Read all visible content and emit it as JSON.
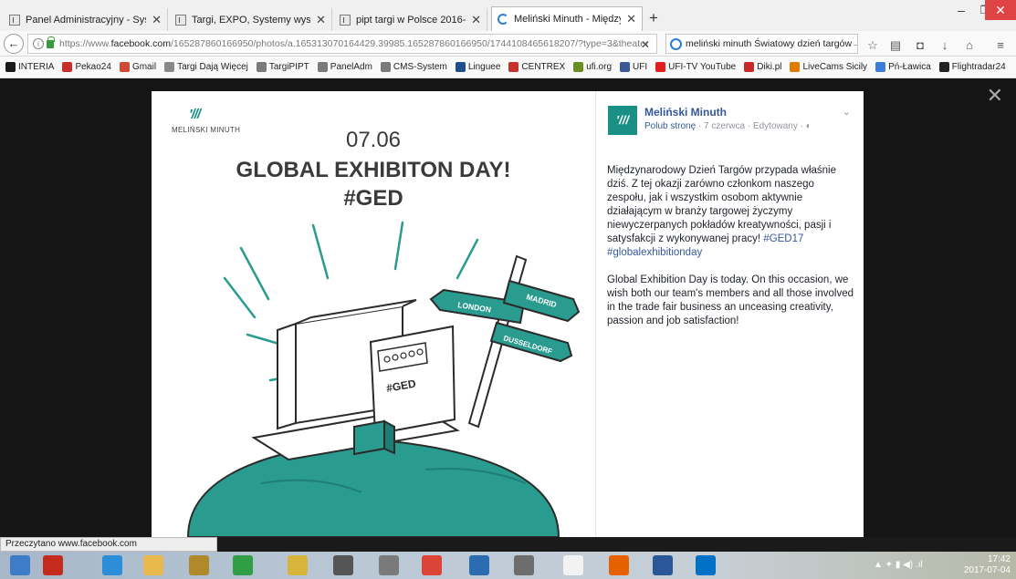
{
  "browser": {
    "tabs": [
      {
        "label": "Panel Administracyjny - Syst",
        "active": false
      },
      {
        "label": "Targi, EXPO, Systemy wystaw",
        "active": false
      },
      {
        "label": "pipt targi w Polsce 2016-cale",
        "active": false
      },
      {
        "label": "Meliński Minuth - Międzyna",
        "active": true
      }
    ],
    "new_tab": "+",
    "window_controls": {
      "minimize": "–",
      "restore": "❐",
      "close": "✕"
    },
    "url": {
      "prefix": "https://www.",
      "domain": "facebook.com",
      "path": "/165287860166950/photos/a.165313070164429.39985.165287860166950/1744108465618207/?type=3&theater"
    },
    "search": {
      "value": "meliński minuth Światowy dzień targów",
      "go": "→"
    },
    "nav_icons": [
      "star-icon",
      "reading-list-icon",
      "pocket-icon",
      "download-icon",
      "home-icon",
      "menu-icon"
    ]
  },
  "bookmarks": [
    {
      "label": "INTERIA",
      "icon": "int",
      "color": "#1a1a1a"
    },
    {
      "label": "Pekao24",
      "icon": "pekao",
      "color": "#c9302c"
    },
    {
      "label": "Gmail",
      "icon": "M",
      "color": "#d14836"
    },
    {
      "label": "Targi Dają Więcej",
      "icon": "TDW",
      "color": "#888888"
    },
    {
      "label": "TargiPIPT",
      "icon": "page",
      "color": "#7a7a7a"
    },
    {
      "label": "PanelAdm",
      "icon": "page",
      "color": "#7a7a7a"
    },
    {
      "label": "CMS-System",
      "icon": "page",
      "color": "#7a7a7a"
    },
    {
      "label": "Linguee",
      "icon": "L",
      "color": "#1f4e8c"
    },
    {
      "label": "CENTREX",
      "icon": "C",
      "color": "#c9302c"
    },
    {
      "label": "ufi.org",
      "icon": "ufi",
      "color": "#6b8e23"
    },
    {
      "label": "UFI",
      "icon": "f",
      "color": "#3b5998"
    },
    {
      "label": "UFI-TV YouTube",
      "icon": "yt",
      "color": "#e02020"
    },
    {
      "label": "Diki.pl",
      "icon": "d",
      "color": "#c82a2a"
    },
    {
      "label": "LiveCams Sicily",
      "icon": "cam",
      "color": "#e07b00"
    },
    {
      "label": "Pń-Ławica",
      "icon": "plane",
      "color": "#3b7dd8"
    },
    {
      "label": "Flightradar24",
      "icon": "fr",
      "color": "#222222"
    }
  ],
  "viewer": {
    "close": "✕",
    "photo": {
      "brand_mark": "'///",
      "brand_name": "MELIŃSKI MINUTH",
      "date": "07.06",
      "headline": "GLOBAL EXHIBITON DAY!",
      "hashtag": "#GED",
      "signs": [
        "LONDON",
        "MADRID",
        "DUSSELDORF"
      ],
      "booth_label": "#GED"
    },
    "post": {
      "page_name": "Meliński Minuth",
      "avatar_text": "'///",
      "like_link": "Polub stronę",
      "meta_rest": " · 7 czerwca · Edytowany · ",
      "privacy_icon": "globe-icon",
      "chevron": "⌄",
      "paragraph_pl": "Międzynarodowy Dzień Targów przypada właśnie dziś. Z tej okazji zarówno członkom naszego zespołu, jak i wszystkim osobom aktywnie działającym w branży targowej życzymy niewyczerpanych pokładów kreatywności, pasji i satysfakcji z wykonywanej pracy!",
      "hashtags_pl": "#GED17 #globalexhibitionday",
      "paragraph_en": "Global Exhibition Day is today. On this occasion, we wish both our team's members and all those involved in the trade fair business an unceasing creativity, passion and job satisfaction!"
    }
  },
  "status_bar": "Przeczytano www.facebook.com",
  "taskbar": {
    "apps": [
      {
        "name": "start",
        "color": "#3d7cc9"
      },
      {
        "name": "power",
        "color": "#c42b1c"
      },
      {
        "name": "ie",
        "color": "#2a8fd8"
      },
      {
        "name": "explorer",
        "color": "#e7b94a"
      },
      {
        "name": "media",
        "color": "#b0892a"
      },
      {
        "name": "store",
        "color": "#2f9e44"
      },
      {
        "name": "photos",
        "color": "#d9b43a"
      },
      {
        "name": "camera",
        "color": "#555555"
      },
      {
        "name": "pen",
        "color": "#7a7a7a"
      },
      {
        "name": "chrome",
        "color": "#db4437"
      },
      {
        "name": "app",
        "color": "#2b6cb0"
      },
      {
        "name": "scanner",
        "color": "#6d6d6d"
      },
      {
        "name": "file",
        "color": "#f2f2f2"
      },
      {
        "name": "firefox",
        "color": "#e66000"
      },
      {
        "name": "word",
        "color": "#2b579a"
      },
      {
        "name": "outlook",
        "color": "#0072c6"
      }
    ],
    "time": "17:42",
    "date": "2017-07-04"
  }
}
